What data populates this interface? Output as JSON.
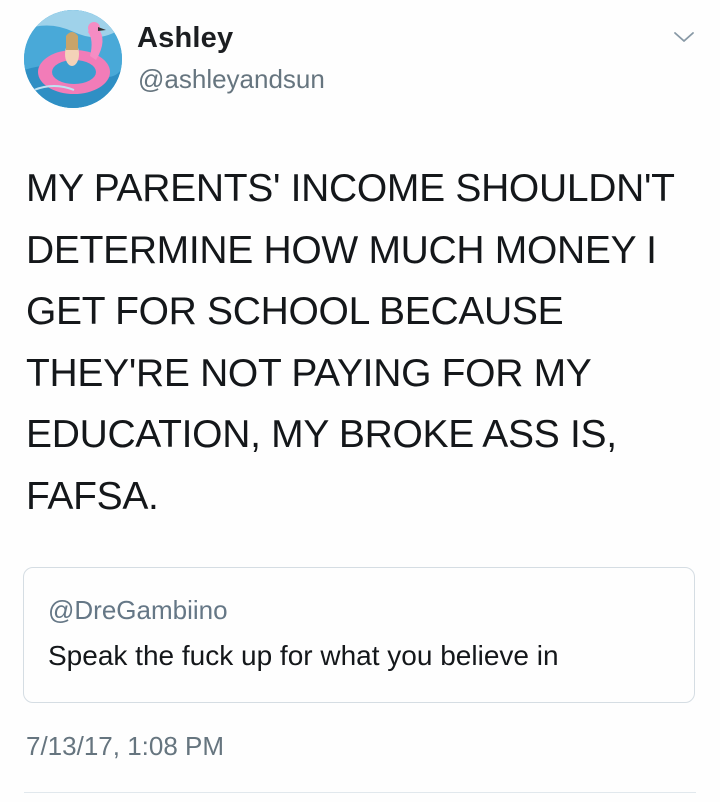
{
  "tweet": {
    "author": {
      "display_name": "Ashley",
      "handle": "@ashleyandsun",
      "avatar": "avatar-pool-flamingo-photo"
    },
    "menu_icon": "chevron-down-icon",
    "text_lines": [
      "MY PARENTS' INCOME SHOULDN'T",
      "DETERMINE HOW MUCH MONEY I",
      "GET FOR SCHOOL BECAUSE",
      "THEY'RE NOT PAYING FOR MY",
      "EDUCATION, MY BROKE ASS IS,",
      "FAFSA."
    ],
    "quoted_tweet": {
      "handle": "@DreGambiino",
      "text": "Speak the fuck up for what you believe in"
    },
    "timestamp": "7/13/17, 1:08 PM"
  },
  "colors": {
    "text": "#14171a",
    "secondary_text": "#66757f",
    "border": "#d5dde3"
  }
}
